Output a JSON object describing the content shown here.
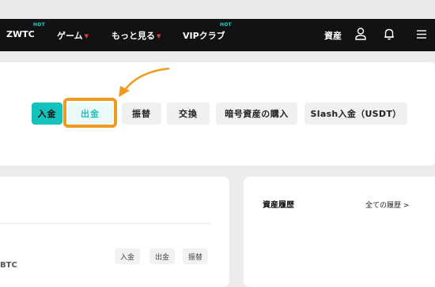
{
  "nav": {
    "items": [
      {
        "label": "ZWTC",
        "hot": "HOT",
        "caret": ""
      },
      {
        "label": "ゲーム",
        "hot": "",
        "caret": "▼"
      },
      {
        "label": "もっと見る",
        "hot": "",
        "caret": "▼"
      },
      {
        "label": "VIPクラブ",
        "hot": "HOT",
        "caret": ""
      }
    ],
    "assets_label": "資産",
    "icons": [
      "user-icon",
      "bell-icon",
      "menu-icon"
    ]
  },
  "tabs": [
    "入金",
    "出金",
    "振替",
    "交換",
    "暗号資産の購入",
    "Slash入金（USDT）"
  ],
  "active_tab": "入金",
  "highlighted_tab": "出金",
  "asset_row": {
    "actions": [
      "入金",
      "出金",
      "振替"
    ],
    "coin": "BTC"
  },
  "history": {
    "title": "資産履歴",
    "link": "全ての履歴 >"
  },
  "colors": {
    "navbar": "#111214",
    "accent": "#13c2bb",
    "hot": "#1dd3c8",
    "caret": "#ef3b3b",
    "highlight_frame": "#f39a1e"
  }
}
